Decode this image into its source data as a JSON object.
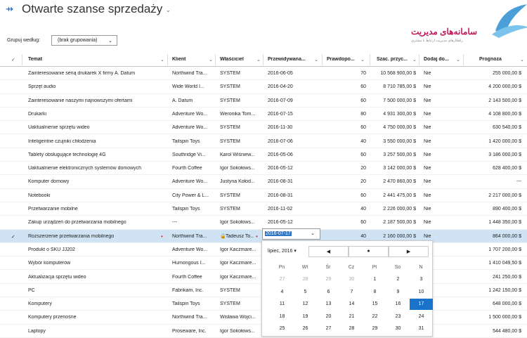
{
  "header": {
    "pin_icon": "pin-icon",
    "title": "Otwarte szanse sprzedaży"
  },
  "logo": {
    "text": "سامانه‌های مدیریت",
    "subtext": "راهکارهای مدیریت ارتباط با مشتری"
  },
  "group": {
    "label": "Grupuj według:",
    "value": "(brak grupowania)"
  },
  "columns": [
    "Temat",
    "Klient",
    "Właściciel",
    "Przewidywana...",
    "Prawdopo...",
    "Szac. przyc...",
    "Dodaj do...",
    "Prognoza"
  ],
  "rows": [
    [
      "Zainteresowanie serią drukarek X firmy A. Datum",
      "Northwind Tra...",
      "SYSTEM",
      "2016-06-05",
      "70",
      "10 568 900,00 $",
      "Nie",
      "255 000,00 $"
    ],
    [
      "Sprzęt audio",
      "Wide World I...",
      "SYSTEM",
      "2016-04-20",
      "60",
      "8 710 785,00 $",
      "Nie",
      "4 200 000,00 $"
    ],
    [
      "Zainteresowanie naszymi najnowszymi ofertami",
      "A. Datum",
      "SYSTEM",
      "2016-07-09",
      "60",
      "7 500 000,00 $",
      "Nie",
      "2 143 500,00 $"
    ],
    [
      "Drukarki",
      "Adventure Wo...",
      "Weronika Tom...",
      "2016-07-15",
      "80",
      "4 931 300,00 $",
      "Nie",
      "4 108 800,00 $"
    ],
    [
      "Uaktualnienie sprzętu wideo",
      "Adventure Wo...",
      "SYSTEM",
      "2016-11-30",
      "60",
      "4 750 000,00 $",
      "Nie",
      "630 540,00 $"
    ],
    [
      "Inteligentne czujniki chłodzenia",
      "Tailspin Toys",
      "SYSTEM",
      "2016-07-06",
      "40",
      "3 550 000,00 $",
      "Nie",
      "1 420 000,00 $"
    ],
    [
      "Tablety obsługujące technologię 4G",
      "Southridge Vi...",
      "Karol Wiśniew...",
      "2016-05-06",
      "60",
      "3 257 500,00 $",
      "Nie",
      "3 186 000,00 $"
    ],
    [
      "Uaktualnienie elektronicznych systemów domowych",
      "Fourth Coffee",
      "Igor Sokołows...",
      "2016-05-12",
      "20",
      "3 142 000,00 $",
      "Nie",
      "628 400,00 $"
    ],
    [
      "Komputer domowy",
      "Adventure Wo...",
      "Justyna Kołod...",
      "2016-08-31",
      "20",
      "2 470 860,00 $",
      "Nie",
      "---"
    ],
    [
      "Notebooki",
      "City Power & L...",
      "SYSTEM",
      "2016-08-31",
      "60",
      "2 441 475,00 $",
      "Nie",
      "2 217 000,00 $"
    ],
    [
      "Przetwarzanie mobilne",
      "Tailspin Toys",
      "SYSTEM",
      "2016-11-02",
      "40",
      "2 226 000,00 $",
      "Nie",
      "890 400,00 $"
    ],
    [
      "Zakup urządzeń do przetwarzania mobilnego",
      "---",
      "Igor Sokołows...",
      "2016-05-12",
      "60",
      "2 187 500,00 $",
      "Nie",
      "1 448 350,00 $"
    ],
    [
      "Rozszerzenie przetwarzania mobilnego",
      "Northwind Tra...",
      "Tadeusz To...",
      "2016-07-17",
      "40",
      "2 160 000,00 $",
      "Nie",
      "864 000,00 $"
    ],
    [
      "Produkt o SKU JJ202",
      "Adventure Wo...",
      "Igor Kaczmare...",
      "",
      "",
      "",
      "",
      "1 707 200,00 $"
    ],
    [
      "Wybór komputerów",
      "Humongous I...",
      "Igor Kaczmare...",
      "",
      "",
      "",
      "",
      "1 410 049,50 $"
    ],
    [
      "Aktualizacja sprzętu wideo",
      "Fourth Coffee",
      "Igor Kaczmare...",
      "",
      "",
      "",
      "",
      "241 250,00 $"
    ],
    [
      "PC",
      "Fabrikam, Inc.",
      "SYSTEM",
      "",
      "",
      "",
      "",
      "1 242 150,00 $"
    ],
    [
      "Komputery",
      "Tailspin Toys",
      "SYSTEM",
      "",
      "",
      "",
      "",
      "648 000,00 $"
    ],
    [
      "Komputery przenośne",
      "Northwind Tra...",
      "Wisława Wojci...",
      "",
      "",
      "",
      "",
      "1 500 000,00 $"
    ],
    [
      "Laptopy",
      "Proseware, Inc.",
      "Igor Sokołows...",
      "",
      "",
      "",
      "",
      "544 480,00 $"
    ]
  ],
  "calendar": {
    "month": "lipiec, 2016",
    "prev": "◀",
    "today": "●",
    "next": "▶",
    "weekdays": [
      "Pn",
      "Wt",
      "Śr",
      "Cz",
      "Pt",
      "So",
      "N"
    ],
    "weeks": [
      [
        "27",
        "28",
        "29",
        "30",
        "1",
        "2",
        "3"
      ],
      [
        "4",
        "5",
        "6",
        "7",
        "8",
        "9",
        "10"
      ],
      [
        "11",
        "12",
        "13",
        "14",
        "15",
        "16",
        "17"
      ],
      [
        "18",
        "19",
        "20",
        "21",
        "22",
        "23",
        "24"
      ],
      [
        "25",
        "26",
        "27",
        "28",
        "29",
        "30",
        "31"
      ]
    ],
    "selected": "17"
  }
}
